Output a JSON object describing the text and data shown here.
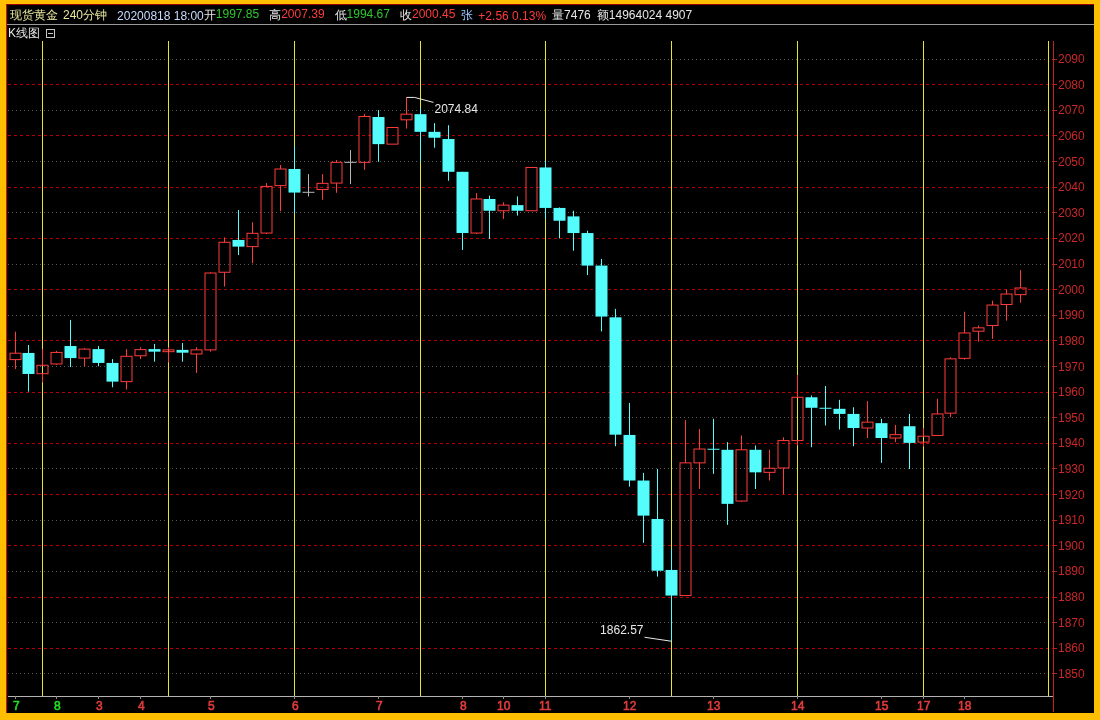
{
  "quote_bar": {
    "symbol": "现货黄金",
    "period": "240分钟",
    "timestamp": "20200818 18:00",
    "fields": [
      {
        "label": "开",
        "value": "1997.85",
        "color": "#2ec82e"
      },
      {
        "label": "高",
        "value": "2007.39",
        "color": "#ff3c3c"
      },
      {
        "label": "低",
        "value": "1994.67",
        "color": "#2ec82e"
      },
      {
        "label": "收",
        "value": "2000.45",
        "color": "#ff3c3c"
      }
    ],
    "change": {
      "label": "张",
      "value": "+2.56 0.13%"
    },
    "volume": "量7476",
    "amount": "额14964024 4907"
  },
  "panel": {
    "title": "K线图"
  },
  "chart": {
    "chart_data": {
      "type": "candlestick",
      "grid": true,
      "ylim": [
        1841.2,
        2096.86
      ],
      "yticks": [
        1850,
        1860,
        1870,
        1880,
        1890,
        1900,
        1910,
        1920,
        1930,
        1940,
        1950,
        1960,
        1970,
        1980,
        1990,
        2000,
        2010,
        2020,
        2030,
        2040,
        2050,
        2060,
        2070,
        2080,
        2090
      ],
      "categories": [
        "7",
        null,
        null,
        "8",
        null,
        null,
        "3",
        null,
        null,
        "4",
        null,
        null,
        null,
        null,
        "5",
        null,
        null,
        null,
        null,
        null,
        "6",
        null,
        null,
        null,
        null,
        null,
        "7",
        null,
        null,
        null,
        null,
        null,
        "8",
        null,
        null,
        "10",
        null,
        null,
        "11",
        null,
        null,
        null,
        null,
        null,
        "12",
        null,
        null,
        null,
        null,
        null,
        "13",
        null,
        null,
        null,
        null,
        null,
        "14",
        null,
        null,
        null,
        null,
        null,
        "15",
        null,
        null,
        "17",
        null,
        null,
        "18",
        null,
        null,
        null,
        null
      ],
      "ohlc": [
        [
          1972.5,
          1983.4,
          1968.8,
          1975.0
        ],
        [
          1975.1,
          1978.2,
          1960.0,
          1966.9
        ],
        [
          1967.0,
          1976.6,
          1963.6,
          1970.3
        ],
        [
          1970.8,
          1975.9,
          1970.5,
          1975.3
        ],
        [
          1977.8,
          1988.0,
          1969.6,
          1973.1
        ],
        [
          1973.1,
          1977.0,
          1969.9,
          1976.6
        ],
        [
          1976.6,
          1977.8,
          1969.9,
          1971.2
        ],
        [
          1971.2,
          1972.7,
          1961.7,
          1963.9
        ],
        [
          1963.9,
          1976.6,
          1960.8,
          1973.8
        ],
        [
          1974.0,
          1977.3,
          1972.7,
          1976.4
        ],
        [
          1976.6,
          1978.6,
          1971.7,
          1975.6
        ],
        [
          1975.6,
          1977.3,
          1971.4,
          1976.3
        ],
        [
          1976.3,
          1979.0,
          1971.7,
          1975.2
        ],
        [
          1974.7,
          1977.3,
          1967.3,
          1976.3
        ],
        [
          1976.3,
          2006.6,
          1975.6,
          2006.3
        ],
        [
          2006.6,
          2020.2,
          2001.0,
          2018.3
        ],
        [
          2019.2,
          2030.9,
          2013.3,
          2016.6
        ],
        [
          2016.6,
          2026.1,
          2010.1,
          2021.8
        ],
        [
          2021.9,
          2041.4,
          2021.5,
          2040.1
        ],
        [
          2040.4,
          2048.5,
          2030.4,
          2046.9
        ],
        [
          2046.9,
          2056.0,
          2029.3,
          2037.7
        ],
        [
          2037.8,
          2044.9,
          2036.2,
          2037.8
        ],
        [
          2038.9,
          2044.9,
          2034.9,
          2041.3
        ],
        [
          2041.4,
          2050.4,
          2037.6,
          2049.5
        ],
        [
          2049.5,
          2054.3,
          2041.0,
          2049.5
        ],
        [
          2049.5,
          2068.3,
          2046.6,
          2067.4
        ],
        [
          2067.2,
          2069.9,
          2049.7,
          2056.6
        ],
        [
          2056.6,
          2063.1,
          2056.6,
          2063.1
        ],
        [
          2066.1,
          2074.84,
          2062.7,
          2068.3
        ],
        [
          2068.3,
          2070.6,
          2049.7,
          2061.4
        ],
        [
          2061.4,
          2064.8,
          2055.2,
          2059.1
        ],
        [
          2058.6,
          2064.0,
          2042.3,
          2045.8
        ],
        [
          2045.8,
          2045.8,
          2015.3,
          2021.9
        ],
        [
          2021.9,
          2037.5,
          2021.5,
          2035.2
        ],
        [
          2035.2,
          2036.5,
          2019.6,
          2030.6
        ],
        [
          2030.6,
          2033.9,
          2027.4,
          2032.8
        ],
        [
          2032.8,
          2036.2,
          2028.7,
          2030.6
        ],
        [
          2030.6,
          2047.5,
          2030.6,
          2047.5
        ],
        [
          2047.5,
          2050.1,
          2027.4,
          2031.7
        ],
        [
          2031.7,
          2031.9,
          2019.8,
          2026.7
        ],
        [
          2028.4,
          2030.6,
          2015.0,
          2021.9
        ],
        [
          2021.9,
          2022.8,
          2005.5,
          2009.2
        ],
        [
          2009.2,
          2011.8,
          1983.5,
          1989.3
        ],
        [
          1989.0,
          1992.3,
          1938.7,
          1943.2
        ],
        [
          1943.1,
          1955.6,
          1922.9,
          1925.3
        ],
        [
          1925.3,
          1928.3,
          1901.0,
          1911.6
        ],
        [
          1910.3,
          1929.8,
          1887.8,
          1890.1
        ],
        [
          1890.4,
          1898.6,
          1862.57,
          1880.4
        ],
        [
          1880.4,
          1948.9,
          1880.4,
          1932.2
        ],
        [
          1932.2,
          1945.4,
          1922.0,
          1937.6
        ],
        [
          1937.7,
          1949.4,
          1927.9,
          1937.4
        ],
        [
          1937.3,
          1940.3,
          1908.0,
          1916.2
        ],
        [
          1917.3,
          1942.9,
          1917.0,
          1937.3
        ],
        [
          1937.3,
          1939.0,
          1922.0,
          1928.5
        ],
        [
          1928.5,
          1937.3,
          1925.3,
          1930.1
        ],
        [
          1930.2,
          1942.2,
          1920.0,
          1940.9
        ],
        [
          1940.9,
          1966.5,
          1939.0,
          1957.8
        ],
        [
          1957.8,
          1958.5,
          1938.3,
          1953.7
        ],
        [
          1953.7,
          1962.2,
          1946.8,
          1953.4
        ],
        [
          1953.3,
          1956.8,
          1945.2,
          1951.3
        ],
        [
          1951.3,
          1953.9,
          1938.7,
          1945.8
        ],
        [
          1945.8,
          1956.3,
          1941.9,
          1948.1
        ],
        [
          1947.7,
          1949.4,
          1932.2,
          1941.9
        ],
        [
          1941.9,
          1947.0,
          1940.3,
          1943.2
        ],
        [
          1946.5,
          1951.3,
          1929.8,
          1940.0
        ],
        [
          1940.3,
          1945.7,
          1938.6,
          1942.6
        ],
        [
          1942.9,
          1957.2,
          1942.9,
          1951.3
        ],
        [
          1951.6,
          1973.4,
          1950.0,
          1972.8
        ],
        [
          1973.0,
          1991.2,
          1972.5,
          1982.9
        ],
        [
          1983.6,
          1985.8,
          1979.5,
          1984.9
        ],
        [
          1985.8,
          1995.5,
          1980.6,
          1993.8
        ],
        [
          1994.0,
          1999.8,
          1987.7,
          1998.1
        ],
        [
          1997.85,
          2007.39,
          1994.67,
          2000.45
        ]
      ],
      "annotations": [
        "2074.84",
        "1862.57"
      ]
    },
    "date_label_colors": [
      {
        "color": "#22dd22"
      },
      {
        "color": "#22dd22"
      },
      {
        "color": "#e03c3c"
      },
      {
        "color": "#e03c3c"
      },
      {
        "color": "#e03c3c"
      },
      {
        "color": "#e03c3c"
      },
      {
        "color": "#e03c3c"
      },
      {
        "color": "#e03c3c"
      },
      {
        "color": "#e03c3c"
      },
      {
        "color": "#e03c3c"
      },
      {
        "color": "#e03c3c"
      },
      {
        "color": "#e03c3c"
      },
      {
        "color": "#e03c3c"
      },
      {
        "color": "#e03c3c"
      },
      {
        "color": "#e03c3c"
      },
      {
        "color": "#e03c3c"
      }
    ]
  }
}
